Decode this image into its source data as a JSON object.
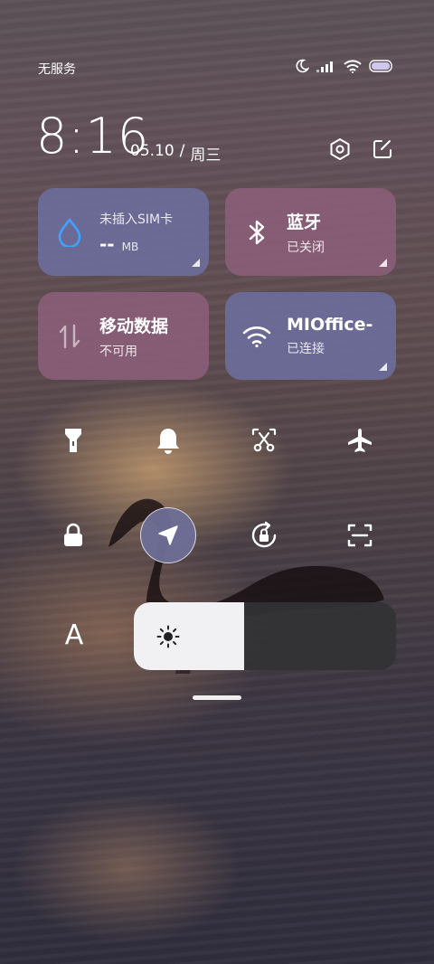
{
  "status_bar": {
    "carrier": "无服务",
    "icons": [
      "moon-icon",
      "signal-icon",
      "wifi-icon",
      "battery-icon"
    ]
  },
  "header": {
    "time": "8:16",
    "date": "05.10",
    "separator": "/",
    "weekday": "周三",
    "buttons": [
      "settings-icon",
      "edit-icon"
    ]
  },
  "tiles": {
    "data_usage": {
      "title": "未插入SIM卡",
      "value": "--",
      "unit": "MB",
      "icon": "water-drop-icon"
    },
    "bluetooth": {
      "title": "蓝牙",
      "status": "已关闭",
      "icon": "bluetooth-icon"
    },
    "mobile_data": {
      "title": "移动数据",
      "status": "不可用",
      "icon": "data-arrows-icon"
    },
    "wifi": {
      "title": "MIOffice-",
      "status": "已连接",
      "icon": "wifi-icon"
    }
  },
  "toggles": [
    {
      "id": "flashlight",
      "icon": "flashlight-icon",
      "on": false
    },
    {
      "id": "sound",
      "icon": "bell-icon",
      "on": false
    },
    {
      "id": "screenshot",
      "icon": "screenshot-scissors-icon",
      "on": false
    },
    {
      "id": "airplane",
      "icon": "airplane-icon",
      "on": false
    },
    {
      "id": "lock",
      "icon": "lock-icon",
      "on": false
    },
    {
      "id": "location",
      "icon": "location-arrow-icon",
      "on": true
    },
    {
      "id": "rotation",
      "icon": "rotation-lock-icon",
      "on": false
    },
    {
      "id": "scanner",
      "icon": "scan-icon",
      "on": false
    }
  ],
  "font_toggle": {
    "label": "A"
  },
  "brightness": {
    "level": 0.42
  },
  "colors": {
    "tile_blue": "#6c6e9e",
    "tile_pink": "#8c5f7a",
    "active_toggle": "#6e6e96",
    "brightness_fill": "#f1f1f3",
    "brightness_track": "#323234"
  }
}
